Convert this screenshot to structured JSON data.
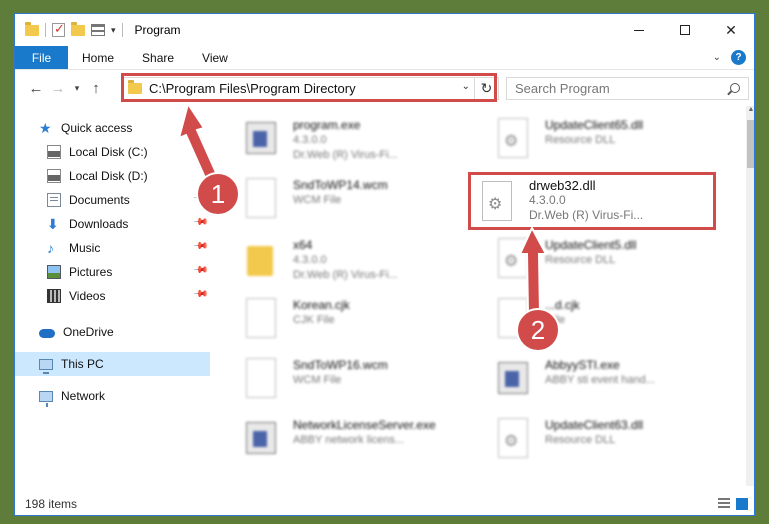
{
  "title": "Program",
  "ribbon": {
    "file": "File",
    "tabs": [
      "Home",
      "Share",
      "View"
    ],
    "help": "?"
  },
  "address": {
    "path": "C:\\Program Files\\Program Directory",
    "search_placeholder": "Search Program"
  },
  "sidebar": {
    "quick_access": "Quick access",
    "items": [
      {
        "label": "Local Disk (C:)",
        "icon": "disk-icon",
        "pinned": false
      },
      {
        "label": "Local Disk (D:)",
        "icon": "disk-icon",
        "pinned": false
      },
      {
        "label": "Documents",
        "icon": "documents-icon",
        "pinned": true
      },
      {
        "label": "Downloads",
        "icon": "downloads-icon",
        "pinned": true
      },
      {
        "label": "Music",
        "icon": "music-icon",
        "pinned": true
      },
      {
        "label": "Pictures",
        "icon": "pictures-icon",
        "pinned": true
      },
      {
        "label": "Videos",
        "icon": "videos-icon",
        "pinned": true
      }
    ],
    "onedrive": "OneDrive",
    "this_pc": "This PC",
    "network": "Network"
  },
  "files": {
    "left": [
      {
        "name": "program.exe",
        "line1": "4.3.0.0",
        "line2": "Dr.Web (R) Virus-Fi..."
      },
      {
        "name": "SndToWP14.wcm",
        "line1": "WCM File",
        "line2": ""
      },
      {
        "name": "x64",
        "line1": "4.3.0.0",
        "line2": "Dr.Web (R) Virus-Fi..."
      },
      {
        "name": "Korean.cjk",
        "line1": "CJK File",
        "line2": ""
      },
      {
        "name": "SndToWP16.wcm",
        "line1": "WCM File",
        "line2": ""
      },
      {
        "name": "NetworkLicenseServer.exe",
        "line1": "ABBY network licens...",
        "line2": ""
      }
    ],
    "right": [
      {
        "name": "UpdateClient65.dll",
        "line1": "Resource DLL",
        "line2": ""
      },
      {
        "name": "UpdateClient5.dll",
        "line1": "Resource DLL",
        "line2": ""
      },
      {
        "name": "...d.cjk",
        "line1": "...ile",
        "line2": ""
      },
      {
        "name": "AbbyySTI.exe",
        "line1": "ABBY sti event hand...",
        "line2": ""
      },
      {
        "name": "UpdateClient63.dll",
        "line1": "Resource DLL",
        "line2": ""
      }
    ],
    "highlighted": {
      "name": "drweb32.dll",
      "version": "4.3.0.0",
      "description": "Dr.Web (R) Virus-Fi..."
    }
  },
  "status": {
    "count": "198 items"
  },
  "callouts": {
    "one": "1",
    "two": "2"
  },
  "colors": {
    "accent": "#1979ca",
    "highlight": "#d24b4b",
    "selection": "#cce8ff"
  }
}
